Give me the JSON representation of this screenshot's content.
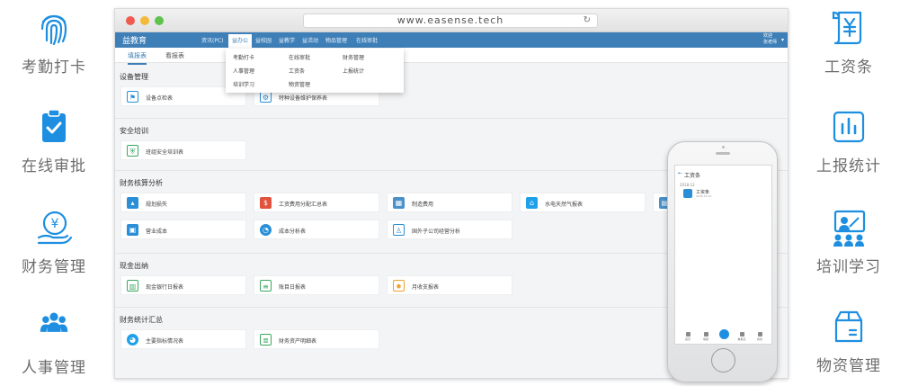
{
  "left_features": [
    {
      "label": "考勤打卡",
      "icon": "fingerprint-icon"
    },
    {
      "label": "在线审批",
      "icon": "clipboard-check-icon"
    },
    {
      "label": "财务管理",
      "icon": "yen-hand-icon"
    },
    {
      "label": "人事管理",
      "icon": "people-icon"
    }
  ],
  "right_features": [
    {
      "label": "工资条",
      "icon": "yen-receipt-icon"
    },
    {
      "label": "上报统计",
      "icon": "bar-report-icon"
    },
    {
      "label": "培训学习",
      "icon": "training-icon"
    },
    {
      "label": "物资管理",
      "icon": "box-icon"
    }
  ],
  "colors": {
    "accent": "#2a8fd6",
    "appbar": "#3e7fb8",
    "icon_blue": "#1e8fe0"
  },
  "browser": {
    "url": "www.easense.tech",
    "app_name": "益教育",
    "nav": [
      "资讯(PC)",
      "益办公",
      "益校园",
      "益教学",
      "益活动",
      "物品管理",
      "在线审批"
    ],
    "active_nav": "益办公",
    "user_line1": "欢迎",
    "user_line2": "张老师",
    "subtabs": [
      "填报表",
      "看报表"
    ],
    "dropdown": [
      [
        "考勤打卡",
        "在线审批",
        "财务管理"
      ],
      [
        "人事管理",
        "工资条",
        "上报统计"
      ],
      [
        "培训学习",
        "物资管理",
        ""
      ]
    ]
  },
  "sections": [
    {
      "title": "设备管理",
      "items": [
        "设备点检表",
        "特种设备维护保养表"
      ]
    },
    {
      "title": "安全培训",
      "items": [
        "班组安全培训表"
      ]
    },
    {
      "title": "财务核算分析",
      "items": [
        "规划损失",
        "工资费用分配汇总表",
        "制造费用",
        "水电天然气报表",
        "营业成本",
        "成本分析表",
        "国外子公司经营分析"
      ]
    },
    {
      "title": "现金出纳",
      "items": [
        "现金银行日报表",
        "账目日报表",
        "月收支报表"
      ]
    },
    {
      "title": "财务统计汇总",
      "items": [
        "主要指标情况表",
        "财务资产明细表"
      ]
    }
  ],
  "phone": {
    "title": "工资条",
    "month": "2018-12",
    "item_title": "工资条",
    "item_date": "2018-12-10",
    "tabs": [
      "首页",
      "填报",
      "",
      "看报表",
      "我的"
    ]
  }
}
